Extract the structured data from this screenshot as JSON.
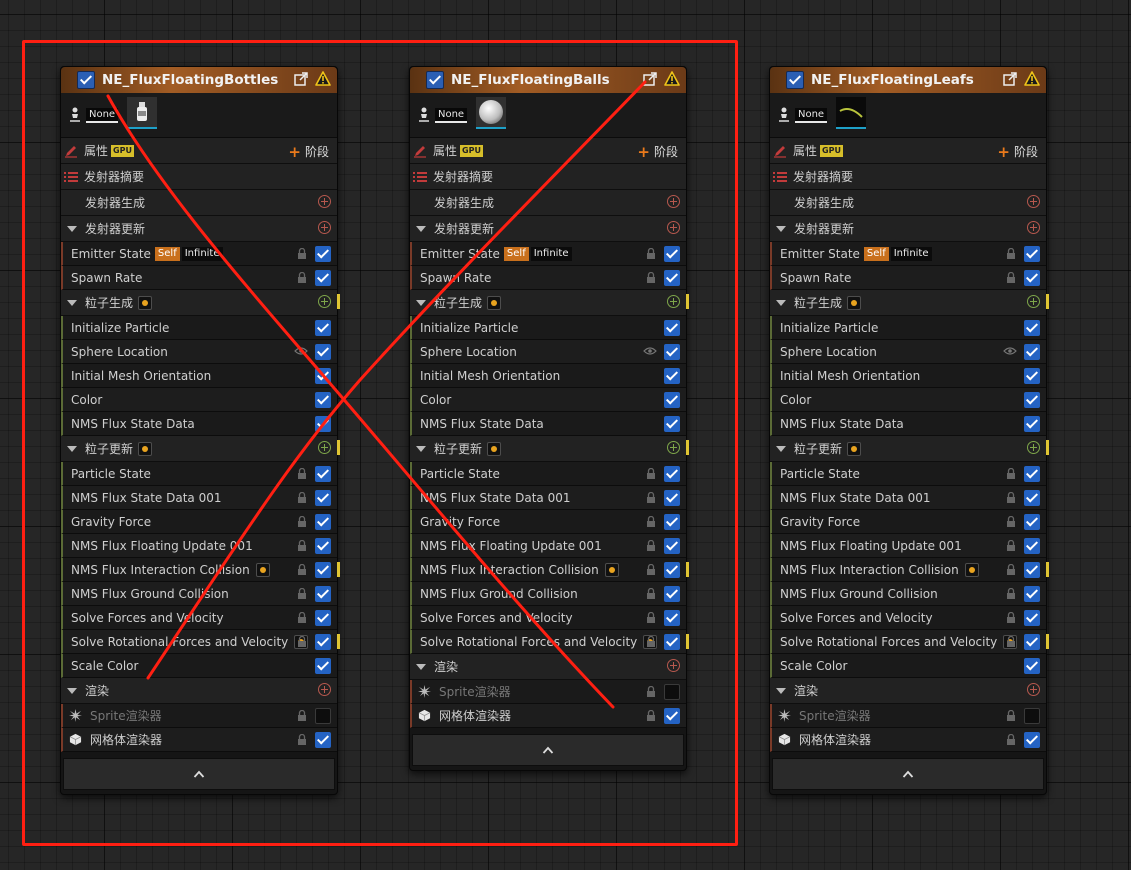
{
  "emitters": [
    {
      "title": "NE_FluxFloatingBottles",
      "preview_label": "None",
      "thumb": "bottle",
      "props_label": "属性",
      "gpu_label": "GPU",
      "stage_label": "阶段",
      "summary_label": "发射器摘要",
      "emitter_spawn_label": "发射器生成",
      "emitter_update_label": "发射器更新",
      "emitter_state": "Emitter State",
      "self_tag": "Self",
      "infinite_tag": "Infinite",
      "spawn_rate": "Spawn Rate",
      "particle_spawn_label": "粒子生成",
      "spawn_modules": [
        "Initialize Particle",
        "Sphere Location",
        "Initial Mesh Orientation",
        "Color",
        "NMS Flux State Data"
      ],
      "particle_update_label": "粒子更新",
      "update_modules": [
        "Particle State",
        "NMS Flux State Data 001",
        "Gravity Force",
        "NMS Flux Floating Update 001",
        "NMS Flux Interaction Collision",
        "NMS Flux Ground Collision",
        "Solve Forces and Velocity",
        "Solve Rotational Forces and Velocity",
        "Scale Color"
      ],
      "render_label": "渲染",
      "sprite_renderer": "Sprite渲染器",
      "mesh_renderer": "网格体渲染器"
    },
    {
      "title": "NE_FluxFloatingBalls",
      "preview_label": "None",
      "thumb": "ball",
      "props_label": "属性",
      "gpu_label": "GPU",
      "stage_label": "阶段",
      "summary_label": "发射器摘要",
      "emitter_spawn_label": "发射器生成",
      "emitter_update_label": "发射器更新",
      "emitter_state": "Emitter State",
      "self_tag": "Self",
      "infinite_tag": "Infinite",
      "spawn_rate": "Spawn Rate",
      "particle_spawn_label": "粒子生成",
      "spawn_modules": [
        "Initialize Particle",
        "Sphere Location",
        "Initial Mesh Orientation",
        "Color",
        "NMS Flux State Data"
      ],
      "particle_update_label": "粒子更新",
      "update_modules": [
        "Particle State",
        "NMS Flux State Data 001",
        "Gravity Force",
        "NMS Flux Floating Update 001",
        "NMS Flux Interaction Collision",
        "NMS Flux Ground Collision",
        "Solve Forces and Velocity",
        "Solve Rotational Forces and Velocity"
      ],
      "render_label": "渲染",
      "sprite_renderer": "Sprite渲染器",
      "mesh_renderer": "网格体渲染器"
    },
    {
      "title": "NE_FluxFloatingLeafs",
      "preview_label": "None",
      "thumb": "leaf",
      "props_label": "属性",
      "gpu_label": "GPU",
      "stage_label": "阶段",
      "summary_label": "发射器摘要",
      "emitter_spawn_label": "发射器生成",
      "emitter_update_label": "发射器更新",
      "emitter_state": "Emitter State",
      "self_tag": "Self",
      "infinite_tag": "Infinite",
      "spawn_rate": "Spawn Rate",
      "particle_spawn_label": "粒子生成",
      "spawn_modules": [
        "Initialize Particle",
        "Sphere Location",
        "Initial Mesh Orientation",
        "Color",
        "NMS Flux State Data"
      ],
      "particle_update_label": "粒子更新",
      "update_modules": [
        "Particle State",
        "NMS Flux State Data 001",
        "Gravity Force",
        "NMS Flux Floating Update 001",
        "NMS Flux Interaction Collision",
        "NMS Flux Ground Collision",
        "Solve Forces and Velocity",
        "Solve Rotational Forces and Velocity",
        "Scale Color"
      ],
      "render_label": "渲染",
      "sprite_renderer": "Sprite渲染器",
      "mesh_renderer": "网格体渲染器"
    }
  ],
  "colors": {
    "header_accent": "#a25c24",
    "checkbox_blue": "#2463c4",
    "annotation_red": "#ff1f12",
    "gpu_badge": "#d7bf2a",
    "self_tag": "#c9701c"
  }
}
